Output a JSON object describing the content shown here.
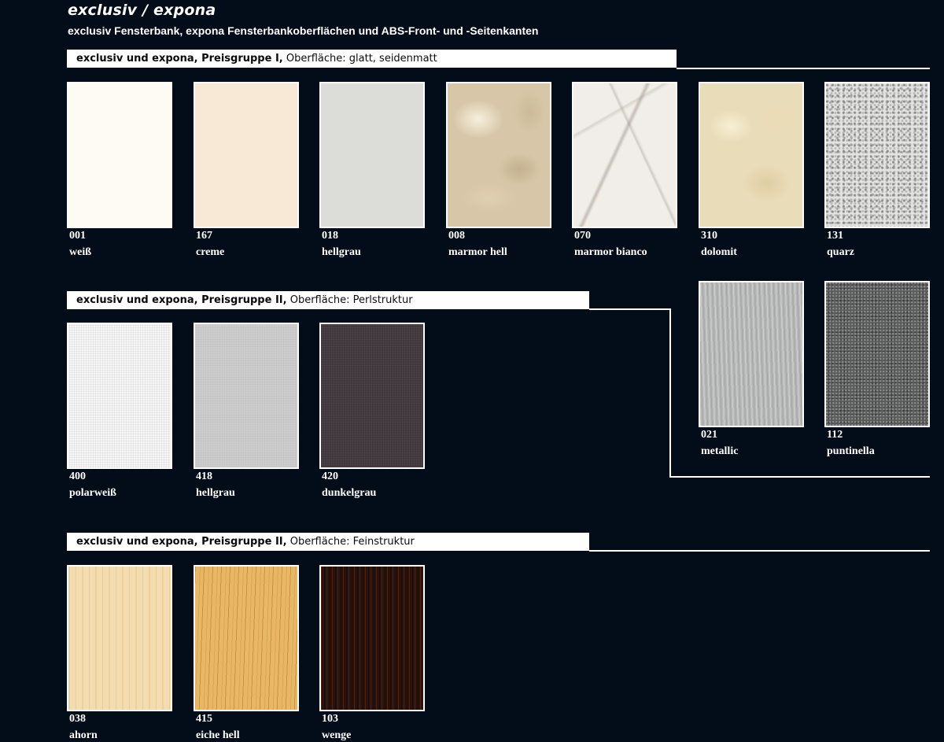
{
  "header": {
    "title": "exclusiv / expona",
    "subtitle": "exclusiv Fensterbank, expona Fensterbankoberflächen und ABS-Front- und -Seitenkanten"
  },
  "sections": [
    {
      "title_bold": "exclusiv und expona, Preisgruppe I,",
      "title_rest": " Oberfläche: glatt, seidenmatt"
    },
    {
      "title_bold": "exclusiv und expona, Preisgruppe II,",
      "title_rest": " Oberfläche: Perlstruktur"
    },
    {
      "title_bold": "exclusiv und expona, Preisgruppe II,",
      "title_rest": " Oberfläche: Feinstruktur"
    }
  ],
  "swatches": [
    {
      "code": "001",
      "name": "weiß",
      "color": "#fdfbf4"
    },
    {
      "code": "167",
      "name": "creme",
      "color": "#f8e8d6"
    },
    {
      "code": "018",
      "name": "hellgrau",
      "color": "#dcdcd8"
    },
    {
      "code": "008",
      "name": "marmor hell",
      "color": "#d7c7a8"
    },
    {
      "code": "070",
      "name": "marmor bianco",
      "color": "#f1eeea"
    },
    {
      "code": "310",
      "name": "dolomit",
      "color": "#e9dcb8"
    },
    {
      "code": "131",
      "name": "quarz",
      "color": "#e4e4e2"
    },
    {
      "code": "021",
      "name": "metallic",
      "color": "#b7b9b8"
    },
    {
      "code": "112",
      "name": "puntinella",
      "color": "#5a5c5b"
    },
    {
      "code": "400",
      "name": "polarweiß",
      "color": "#f6f6f6"
    },
    {
      "code": "418",
      "name": "hellgrau",
      "color": "#cfcece"
    },
    {
      "code": "420",
      "name": "dunkelgrau",
      "color": "#3e373b"
    },
    {
      "code": "038",
      "name": "ahorn",
      "color": "#f3dcb0"
    },
    {
      "code": "415",
      "name": "eiche hell",
      "color": "#e8b765"
    },
    {
      "code": "103",
      "name": "wenge",
      "color": "#2a120c"
    }
  ],
  "colors": {
    "background": "#020d19",
    "bar": "#ffffff",
    "text": "#ffffff"
  }
}
